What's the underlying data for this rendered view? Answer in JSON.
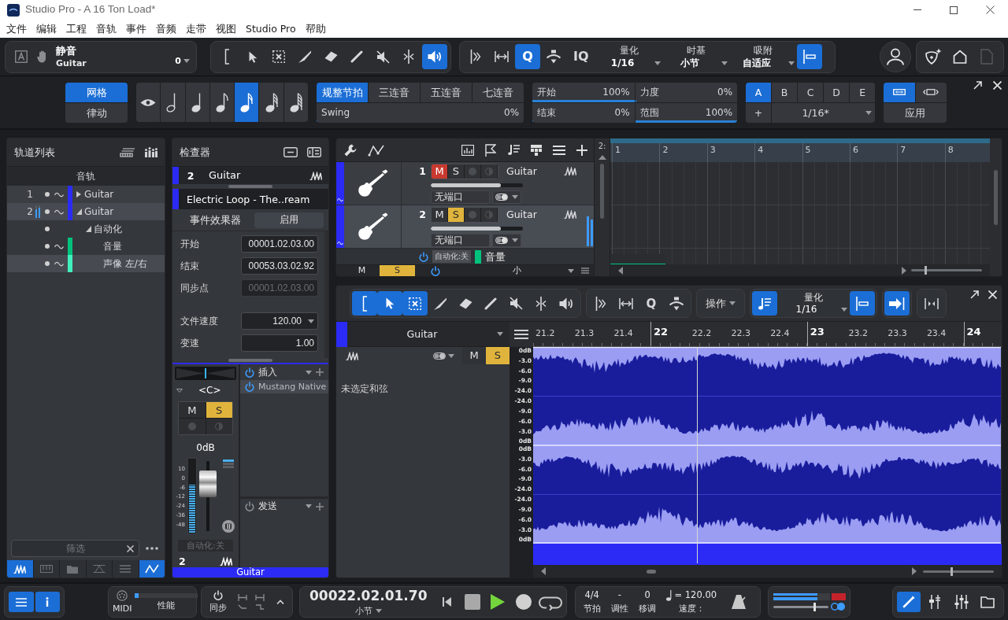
{
  "window": {
    "title": "Studio Pro - A 16 Ton Load*"
  },
  "menu": [
    "文件",
    "编辑",
    "工程",
    "音轨",
    "事件",
    "音频",
    "走带",
    "视图",
    "Studio Pro",
    "帮助"
  ],
  "toolbar": {
    "info": {
      "title": "静音",
      "track": "Guitar",
      "value": "0"
    },
    "tools": [
      {
        "kind": "range",
        "selected": false
      },
      {
        "kind": "arrow",
        "selected": false
      },
      {
        "kind": "select",
        "selected": false
      },
      {
        "kind": "knife",
        "selected": false
      },
      {
        "kind": "eraser",
        "selected": false
      },
      {
        "kind": "pencil",
        "selected": false
      },
      {
        "kind": "mute",
        "selected": false
      },
      {
        "kind": "split",
        "selected": false
      },
      {
        "kind": "listen",
        "selected": true
      }
    ],
    "edit_tools": [
      {
        "kind": "bend",
        "selected": false
      },
      {
        "kind": "stretch",
        "selected": false
      },
      {
        "kind": "letter",
        "label": "Q",
        "selected": true
      },
      {
        "kind": "strum",
        "selected": false
      },
      {
        "kind": "letter",
        "label": "IQ",
        "selected": false
      }
    ],
    "dropdowns": [
      {
        "label": "量化",
        "value": "1/16"
      },
      {
        "label": "时基",
        "value": "小节"
      },
      {
        "label": "吸附",
        "value": "自适应"
      }
    ],
    "snap": {
      "on": true
    },
    "right_buttons": [
      {
        "kind": "shield",
        "disabled": false
      },
      {
        "kind": "home",
        "disabled": false
      },
      {
        "kind": "page",
        "disabled": true
      }
    ]
  },
  "quantize_panel": {
    "modes": [
      {
        "label": "网格",
        "selected": true
      },
      {
        "label": "律动",
        "selected": false
      }
    ],
    "note_values": [
      {
        "kind": "eye",
        "selected": false
      },
      {
        "kind": "half",
        "selected": false
      },
      {
        "kind": "quarter",
        "selected": false
      },
      {
        "kind": "eighth",
        "selected": false
      },
      {
        "kind": "sixteenth",
        "selected": true
      },
      {
        "kind": "thirty_second",
        "selected": false
      },
      {
        "kind": "sixty_fourth",
        "selected": false
      }
    ],
    "timing": [
      {
        "label": "规整节拍",
        "selected": true
      },
      {
        "label": "三连音",
        "selected": false
      },
      {
        "label": "五连音",
        "selected": false
      },
      {
        "label": "七连音",
        "selected": false
      }
    ],
    "swing": {
      "label": "Swing",
      "value": "0%",
      "level": 0
    },
    "params": [
      {
        "label": "开始",
        "value": "100%",
        "level": 1
      },
      {
        "label": "力度",
        "value": "0%",
        "level": 0
      },
      {
        "label": "结束",
        "value": "0%",
        "level": 0
      },
      {
        "label": "范围",
        "value": "100%",
        "level": 1
      }
    ],
    "presets": [
      {
        "label": "A",
        "selected": true
      },
      {
        "label": "B",
        "selected": false
      },
      {
        "label": "C",
        "selected": false
      },
      {
        "label": "D",
        "selected": false
      },
      {
        "label": "E",
        "selected": false
      }
    ],
    "preset_add": "+",
    "preset_value": "1/16*",
    "apply_modes": [
      {
        "kind": "wide",
        "selected": true
      },
      {
        "kind": "narrow",
        "selected": false
      }
    ],
    "apply": "应用"
  },
  "track_list": {
    "title": "轨道列表",
    "header": "音轨",
    "tracks": [
      {
        "number": "1",
        "name": "Guitar",
        "color": "#2b2bf5",
        "selected": false,
        "expanded": false,
        "meter_active": false
      },
      {
        "number": "2",
        "name": "Guitar",
        "color": "#2b2bf5",
        "selected": true,
        "expanded": true,
        "meter_active": true,
        "children": [
          {
            "name": "自动化",
            "selected": false,
            "expanded": true,
            "children": [
              {
                "name": "音量",
                "color": "#00c27c",
                "selected": false
              },
              {
                "name": "声像 左/右",
                "color": "#3ff0bd",
                "selected": true
              }
            ]
          }
        ]
      }
    ],
    "filter": {
      "placeholder": "筛选"
    },
    "tabs": [
      {
        "kind": "audio",
        "selected": true
      },
      {
        "kind": "keys",
        "selected": false
      },
      {
        "kind": "folder",
        "selected": false
      },
      {
        "kind": "fx",
        "selected": false
      },
      {
        "kind": "list",
        "selected": false
      },
      {
        "kind": "automation",
        "selected": true
      }
    ]
  },
  "inspector": {
    "title": "检查器",
    "track": {
      "number": "2",
      "name": "Guitar",
      "color": "#2b2bf5"
    },
    "event": {
      "name": "Electric Loop - The..ream",
      "color": "#2b2bf5"
    },
    "event_fx": {
      "label": "事件效果器",
      "button": "启用"
    },
    "position_fields": [
      {
        "label": "开始",
        "value": "00001.02.03.00",
        "disabled": false
      },
      {
        "label": "结束",
        "value": "00053.03.02.92",
        "disabled": false
      },
      {
        "label": "同步点",
        "value": "00001.02.03.00",
        "disabled": true
      }
    ],
    "file_fields": [
      {
        "label": "文件速度",
        "value": "120.00",
        "kind": "dropdown"
      },
      {
        "label": "变速",
        "value": "1.00",
        "kind": "text"
      }
    ],
    "channel": {
      "pan": "<C>",
      "mute": {
        "label": "M",
        "on": false
      },
      "solo": {
        "label": "S",
        "on": true
      },
      "record": false,
      "monitor": false,
      "volume": "0dB",
      "scale": [
        "10",
        "0",
        "-6",
        "-12",
        "-24",
        "-36",
        "-48"
      ],
      "meter": {
        "level": 0.64
      },
      "fader": {
        "level": 0.66
      },
      "automation": "自动化:关",
      "number": "2",
      "name": "Guitar",
      "color": "#2b2bf5"
    },
    "inserts": {
      "title": "插入",
      "on": true,
      "items": [
        {
          "name": "Mustang Native",
          "on": true
        }
      ]
    },
    "sends": {
      "title": "发送",
      "on": false
    }
  },
  "arrange": {
    "tracks": [
      {
        "number": "1",
        "name": "Guitar",
        "color": "#2b2bf5",
        "selected": false,
        "mute": {
          "label": "M",
          "on": true
        },
        "solo": {
          "label": "S",
          "on": false
        },
        "record": false,
        "monitor": false,
        "volume": {
          "level": 0.76
        },
        "port": "无端口",
        "meter_active": false
      },
      {
        "number": "2",
        "name": "Guitar",
        "color": "#2b2bf5",
        "selected": true,
        "mute": {
          "label": "M",
          "on": false
        },
        "solo": {
          "label": "S",
          "on": true
        },
        "record": false,
        "monitor": false,
        "volume": {
          "level": 0.76
        },
        "port": "无端口",
        "meter_active": true
      }
    ],
    "automation_lane": {
      "on": true,
      "mode": "自动化:关",
      "color": "#00c27c",
      "name": "音量"
    },
    "footer": {
      "toggles": [
        {
          "label": "M",
          "on": false
        },
        {
          "label": "S",
          "on": true
        }
      ],
      "power": true,
      "size": "小"
    },
    "position": "2:",
    "ruler": [
      "1",
      "2",
      "3",
      "4",
      "5",
      "6",
      "7",
      "8"
    ],
    "zoom": {
      "level": 0.2
    }
  },
  "editor": {
    "tools": [
      {
        "kind": "range",
        "selected": true
      },
      {
        "kind": "arrow",
        "selected": true
      },
      {
        "kind": "select",
        "selected": true
      },
      {
        "kind": "knife",
        "selected": false
      },
      {
        "kind": "eraser",
        "selected": false
      },
      {
        "kind": "pencil",
        "selected": false
      },
      {
        "kind": "mute",
        "selected": false
      },
      {
        "kind": "split",
        "selected": false
      },
      {
        "kind": "listen",
        "selected": false
      }
    ],
    "edit_tools": [
      {
        "kind": "bend",
        "selected": false
      },
      {
        "kind": "stretch",
        "selected": false
      },
      {
        "kind": "letter",
        "label": "Q",
        "selected": false
      },
      {
        "kind": "strum",
        "selected": false
      }
    ],
    "action": "操作",
    "quantize_tool": {
      "on": true
    },
    "quantize": {
      "label": "量化",
      "value": "1/16"
    },
    "snap": {
      "on": true
    },
    "follow": {
      "on": true
    },
    "fit": {
      "on": false
    },
    "track": {
      "name": "Guitar",
      "color": "#2b2bf5",
      "mute": {
        "label": "M",
        "on": false
      },
      "solo": {
        "label": "S",
        "on": true
      }
    },
    "chord": "未选定和弦",
    "ruler": [
      {
        "label": "21.2",
        "major": false
      },
      {
        "label": "21.3",
        "major": false
      },
      {
        "label": "21.4",
        "major": false
      },
      {
        "label": "22",
        "major": true
      },
      {
        "label": "22.2",
        "major": false
      },
      {
        "label": "22.3",
        "major": false
      },
      {
        "label": "22.4",
        "major": false
      },
      {
        "label": "23",
        "major": true
      },
      {
        "label": "23.2",
        "major": false
      },
      {
        "label": "23.3",
        "major": false
      },
      {
        "label": "23.4",
        "major": false
      },
      {
        "label": "24",
        "major": true
      }
    ],
    "channels": [
      {
        "scale": [
          "0dB",
          "-3.0",
          "-6.0",
          "-9.0",
          "-24.0",
          "-24.0",
          "-9.0",
          "-6.0",
          "-3.0",
          "0dB"
        ]
      },
      {
        "scale": [
          "0dB",
          "-3.0",
          "-6.0",
          "-9.0",
          "-24.0",
          "-24.0",
          "-9.0",
          "-6.0",
          "-3.0",
          "0dB"
        ]
      }
    ],
    "zoom": {
      "level": 0.4
    }
  },
  "transport": {
    "view_buttons": [
      {
        "kind": "list",
        "selected": true
      },
      {
        "kind": "info",
        "selected": true
      }
    ],
    "midi": {
      "label": "MIDI",
      "performance": "性能",
      "level": 0.06
    },
    "sync": {
      "label": "同步"
    },
    "time": {
      "value": "00022.02.01.70",
      "format": "小节"
    },
    "controls": [
      {
        "kind": "rewind"
      },
      {
        "kind": "stop"
      },
      {
        "kind": "play"
      },
      {
        "kind": "record"
      },
      {
        "kind": "loop"
      }
    ],
    "signature": [
      {
        "value": "4/4",
        "label": "节拍"
      },
      {
        "value": "-",
        "label": "调性"
      },
      {
        "value": "0",
        "label": "移调"
      }
    ],
    "tempo": {
      "value": "= 120.00",
      "label": "速度："
    },
    "output": {
      "meter": {
        "level": 0.78
      },
      "clip": true,
      "volume": {
        "level": 0.74
      }
    },
    "panels": [
      {
        "kind": "edit",
        "selected": true
      },
      {
        "kind": "channel",
        "selected": false
      },
      {
        "kind": "mix",
        "selected": false
      },
      {
        "kind": "browse",
        "selected": false
      }
    ]
  }
}
